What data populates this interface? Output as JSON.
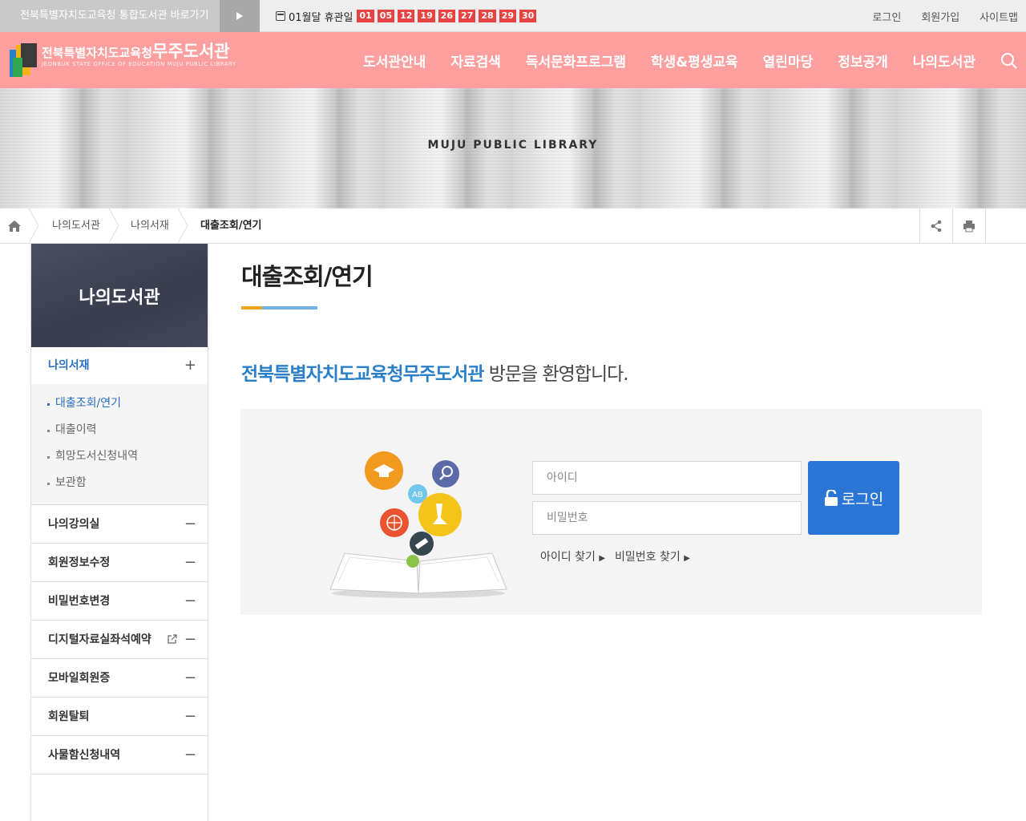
{
  "topbar": {
    "integrated_link": "전북특별자치도교육청 통합도서관 바로가기",
    "closed_label": "01월달 휴관일",
    "closed_days": [
      "01",
      "05",
      "12",
      "19",
      "26",
      "27",
      "28",
      "29",
      "30"
    ],
    "util": [
      "로그인",
      "회원가입",
      "사이트맵"
    ]
  },
  "header": {
    "logo_line1_prefix": "전북특별자치도교육청",
    "logo_line1_name": "무주도서관",
    "logo_line2": "JEONBUK STATE OFFICE OF EDUCATION MUJU PUBLIC LIBRARY",
    "gnb": [
      "도서관안내",
      "자료검색",
      "독서문화프로그램",
      "학생&평생교육",
      "열린마당",
      "정보공개",
      "나의도서관"
    ]
  },
  "visual": {
    "text": "MUJU PUBLIC LIBRARY"
  },
  "breadcrumb": [
    "나의도서관",
    "나의서재",
    "대출조회/연기"
  ],
  "sidebar": {
    "title": "나의도서관",
    "active": "나의서재",
    "sub": [
      "대출조회/연기",
      "대출이력",
      "희망도서신청내역",
      "보관함"
    ],
    "items": [
      "나의강의실",
      "회원정보수정",
      "비밀번호변경",
      "디지털자료실좌석예약",
      "모바일회원증",
      "회원탈퇴",
      "사물함신청내역"
    ]
  },
  "content": {
    "title": "대출조회/연기",
    "welcome_name": "전북특별자치도교육청무주도서관",
    "welcome_rest": " 방문을 환영합니다.",
    "id_placeholder": "아이디",
    "pw_placeholder": "비밀번호",
    "login_label": "로그인",
    "find_id": "아이디 찾기",
    "find_pw": "비밀번호 찾기"
  },
  "colors": {
    "header": "#fd9f9f",
    "accent": "#2a7fc9",
    "closed_day": "#e84343",
    "login_button": "#2a75d6"
  }
}
